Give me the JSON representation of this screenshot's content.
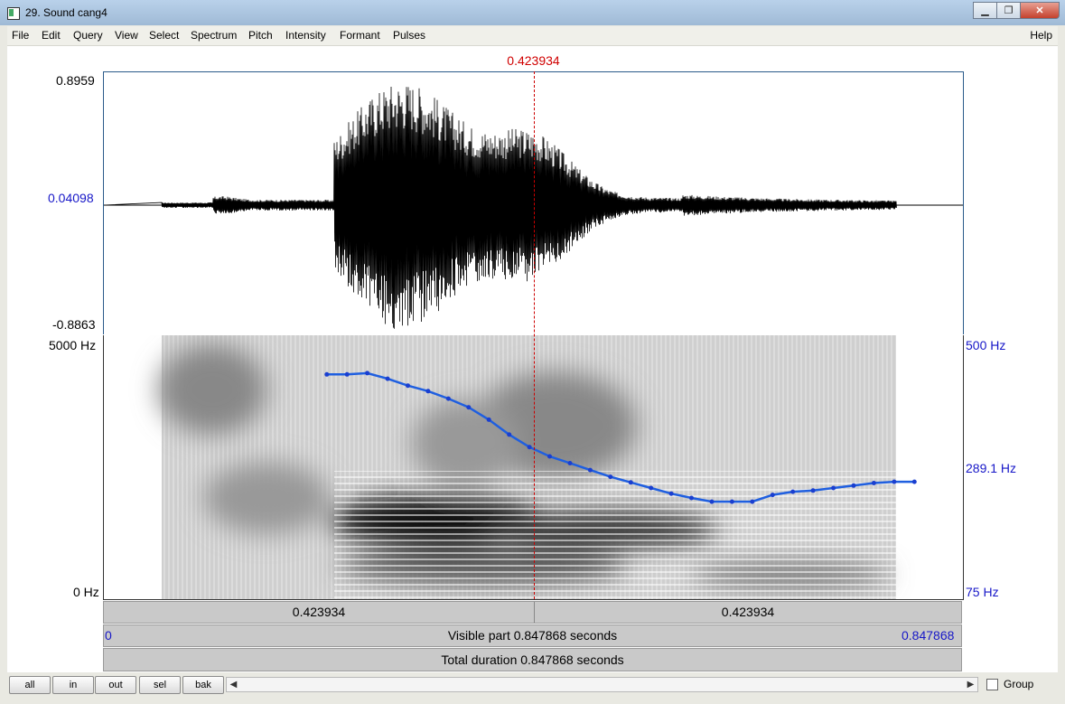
{
  "window": {
    "title": "29. Sound cang4"
  },
  "menu": {
    "items": [
      "File",
      "Edit",
      "Query",
      "View",
      "Select",
      "Spectrum",
      "Pitch",
      "Intensity",
      "Formant",
      "Pulses"
    ],
    "help": "Help"
  },
  "cursor": {
    "time_label": "0.423934"
  },
  "waveform": {
    "max_label": "0.8959",
    "mid_label": "0.04098",
    "min_label": "-0.8863"
  },
  "spectrogram": {
    "top_label": "5000 Hz",
    "bottom_label": "0 Hz"
  },
  "pitch": {
    "top_label": "500 Hz",
    "mid_label": "289.1 Hz",
    "bottom_label": "75 Hz"
  },
  "timebar": {
    "left_segment": "0.423934",
    "right_segment": "0.423934",
    "visible_part": "Visible part 0.847868 seconds",
    "visible_start": "0",
    "visible_end": "0.847868",
    "total_duration": "Total duration 0.847868 seconds"
  },
  "bottom": {
    "buttons": [
      "all",
      "in",
      "out",
      "sel",
      "bak"
    ],
    "group_label": "Group"
  },
  "chart_data": {
    "type": "line",
    "title": "",
    "xlabel": "",
    "ylabel": "",
    "xlim": [
      0,
      0.847868
    ],
    "ylim": [
      75,
      500
    ],
    "series": [
      {
        "x": [
          0.22,
          0.24,
          0.26,
          0.28,
          0.3,
          0.32,
          0.34,
          0.36,
          0.38,
          0.4,
          0.42,
          0.44,
          0.46,
          0.48,
          0.5,
          0.52,
          0.54,
          0.56,
          0.58,
          0.6,
          0.62,
          0.64,
          0.66,
          0.68,
          0.7,
          0.72,
          0.74,
          0.76,
          0.78,
          0.8
        ],
        "values": [
          437,
          437,
          439,
          430,
          419,
          410,
          398,
          384,
          364,
          340,
          320,
          305,
          294,
          283,
          272,
          263,
          254,
          245,
          238,
          232,
          232,
          232,
          243,
          248,
          250,
          254,
          258,
          262,
          264,
          264
        ]
      }
    ]
  }
}
